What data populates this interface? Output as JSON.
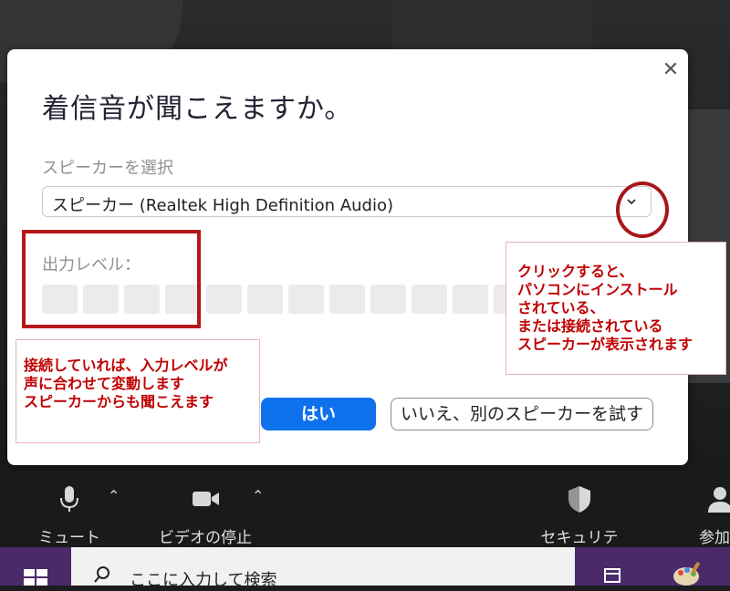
{
  "dialog": {
    "close_symbol": "✕",
    "title": "着信音が聞こえますか。",
    "select_label": "スピーカーを選択",
    "speaker_value": "スピーカー (Realtek High Definition Audio)",
    "level_label": "出力レベル：",
    "level_percent": 0,
    "yes_button": "はい",
    "no_button": "いいえ、別のスピーカーを試す"
  },
  "annotations": {
    "left_note": "接続していれば、入力レベルが\n声に合わせて変動します\nスピーカーからも聞こえます",
    "right_note": "クリックすると、\nパソコンにインストール\nされている、\nまたは接続されている\nスピーカーが表示されます"
  },
  "toolbar": {
    "mute_label": "ミュート",
    "video_label": "ビデオの停止",
    "security_label": "セキュリティ",
    "participants_label": "参加"
  },
  "taskbar": {
    "search_placeholder": "ここに入力して検索"
  },
  "icons": {
    "close": "close-icon",
    "chevron": "chevron-down-icon",
    "mic": "microphone-icon",
    "video": "video-camera-icon",
    "security": "shield-icon",
    "participants": "person-icon",
    "windows": "windows-logo-icon",
    "search": "search-icon",
    "taskview": "task-view-icon",
    "paint": "paint-icon"
  },
  "colors": {
    "accent_blue": "#0e72ed",
    "annotation_red": "#c00000",
    "taskbar_purple": "#4b2a6a"
  }
}
